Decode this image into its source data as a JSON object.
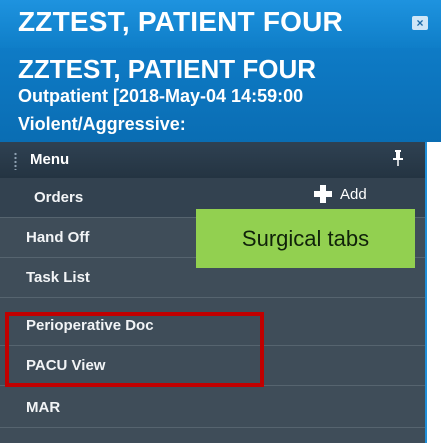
{
  "window": {
    "title": "ZZTEST, PATIENT FOUR",
    "close_glyph": "×"
  },
  "banner": {
    "patient_name": "ZZTEST, PATIENT FOUR",
    "encounter": "Outpatient [2018-May-04 14:59:00",
    "alert": "Violent/Aggressive:"
  },
  "menu": {
    "header": "Menu",
    "pin_glyph": "ᵖ",
    "add_label": "Add",
    "items": [
      {
        "label": "Orders"
      },
      {
        "label": "Hand Off"
      },
      {
        "label": "Task List"
      },
      {
        "label": "Perioperative Doc"
      },
      {
        "label": "PACU View"
      },
      {
        "label": "MAR"
      }
    ]
  },
  "annotation": {
    "callout": "Surgical tabs"
  },
  "colors": {
    "title_bar": "#1587d4",
    "menu_background": "#3f4d59",
    "callout": "#92d050",
    "highlight": "#c00000"
  },
  "icons": [
    "close-icon",
    "grip-icon",
    "pin-icon",
    "plus-icon"
  ]
}
